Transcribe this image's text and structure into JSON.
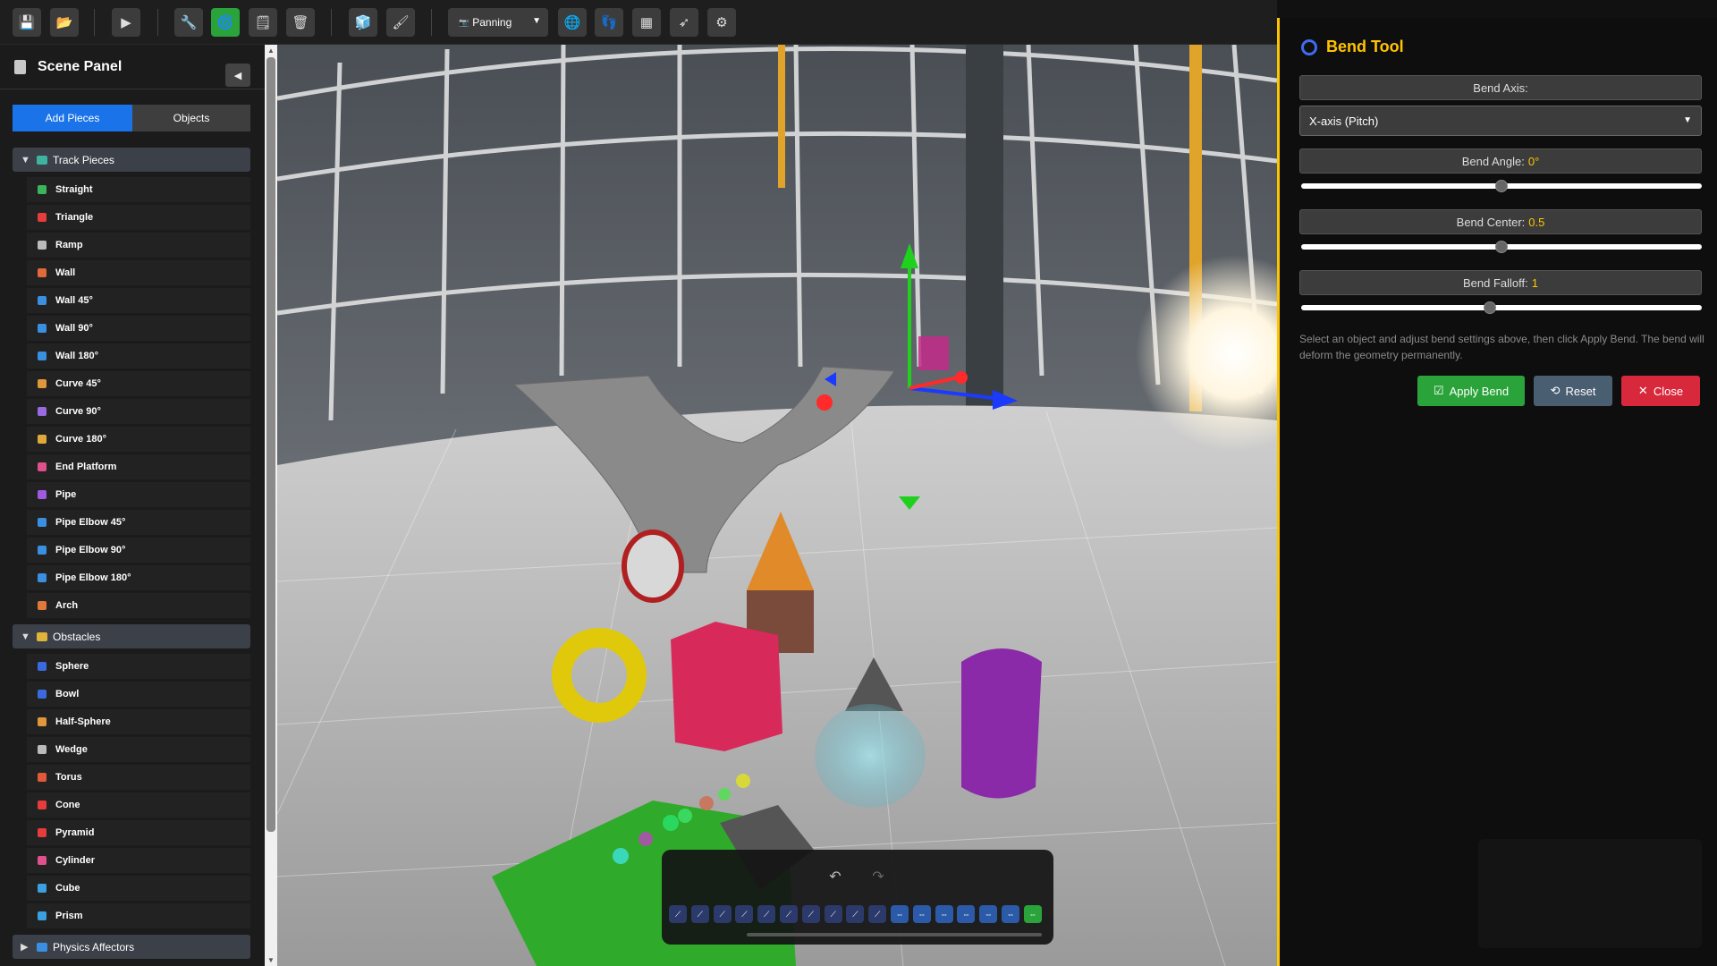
{
  "toolbar": {
    "buttons": [
      {
        "name": "save-button",
        "icon": "save-icon",
        "glyph": "💾"
      },
      {
        "name": "open-button",
        "icon": "folder-icon",
        "glyph": "📂"
      },
      {
        "name": "play-button",
        "icon": "play-icon",
        "glyph": "▶"
      },
      {
        "name": "tools-button",
        "icon": "wrench-icon",
        "glyph": "🔧"
      },
      {
        "name": "bend-tool-button",
        "icon": "bend-icon",
        "glyph": "🌀"
      },
      {
        "name": "notes-button",
        "icon": "notepad-icon",
        "glyph": "🗒"
      },
      {
        "name": "delete-button",
        "icon": "trash-icon",
        "glyph": "🗑"
      },
      {
        "name": "add-cube-button",
        "icon": "cube-icon",
        "glyph": "🧊"
      },
      {
        "name": "paint-button",
        "icon": "brush-icon",
        "glyph": "🖌"
      },
      {
        "name": "physics-button",
        "icon": "globe-icon",
        "glyph": "🌐"
      },
      {
        "name": "footprints-button",
        "icon": "footprints-icon",
        "glyph": "👣"
      },
      {
        "name": "checker-button",
        "icon": "checker-icon",
        "glyph": "▦"
      },
      {
        "name": "slide-button",
        "icon": "slide-icon",
        "glyph": "➶"
      },
      {
        "name": "settings-button",
        "icon": "gear-icon",
        "glyph": "⚙"
      }
    ],
    "mode": {
      "label": "Panning",
      "icon": "camera-icon"
    }
  },
  "scene_panel": {
    "title": "Scene Panel",
    "tabs": {
      "add": "Add Pieces",
      "objects": "Objects"
    },
    "categories": [
      {
        "label": "Track Pieces",
        "expanded": "▼",
        "color": "#3cb4a0",
        "items": [
          {
            "label": "Straight",
            "color": "#3cb45a"
          },
          {
            "label": "Triangle",
            "color": "#e63c3c"
          },
          {
            "label": "Ramp",
            "color": "#bbbbbb"
          },
          {
            "label": "Wall",
            "color": "#e06a3a"
          },
          {
            "label": "Wall 45°",
            "color": "#3a8fe0"
          },
          {
            "label": "Wall 90°",
            "color": "#3a8fe0"
          },
          {
            "label": "Wall 180°",
            "color": "#3a8fe0"
          },
          {
            "label": "Curve 45°",
            "color": "#e0963a"
          },
          {
            "label": "Curve 90°",
            "color": "#9a6ae0"
          },
          {
            "label": "Curve 180°",
            "color": "#e0a83a"
          },
          {
            "label": "End Platform",
            "color": "#e0508a"
          },
          {
            "label": "Pipe",
            "color": "#a05ae0"
          },
          {
            "label": "Pipe Elbow 45°",
            "color": "#3a8fe0"
          },
          {
            "label": "Pipe Elbow 90°",
            "color": "#3a8fe0"
          },
          {
            "label": "Pipe Elbow 180°",
            "color": "#3a8fe0"
          },
          {
            "label": "Arch",
            "color": "#e0783a"
          }
        ]
      },
      {
        "label": "Obstacles",
        "expanded": "▼",
        "color": "#e0b43a",
        "items": [
          {
            "label": "Sphere",
            "color": "#3a6ae0"
          },
          {
            "label": "Bowl",
            "color": "#3a6ae0"
          },
          {
            "label": "Half-Sphere",
            "color": "#e0963a"
          },
          {
            "label": "Wedge",
            "color": "#bbbbbb"
          },
          {
            "label": "Torus",
            "color": "#e05a3a"
          },
          {
            "label": "Cone",
            "color": "#e63c3c"
          },
          {
            "label": "Pyramid",
            "color": "#e63c3c"
          },
          {
            "label": "Cylinder",
            "color": "#e0508a"
          },
          {
            "label": "Cube",
            "color": "#3aa0e0"
          },
          {
            "label": "Prism",
            "color": "#3aa0e0"
          }
        ]
      },
      {
        "label": "Physics Affectors",
        "expanded": "▶",
        "color": "#3a8fe0",
        "items": []
      }
    ]
  },
  "bend_tool": {
    "title": "Bend Tool",
    "axis_label": "Bend Axis:",
    "axis_value": "X-axis (Pitch)",
    "angle_label": "Bend Angle:",
    "angle_value": "0°",
    "angle_level": 0.5,
    "center_label": "Bend Center:",
    "center_value": "0.5",
    "center_level": 0.5,
    "falloff_label": "Bend Falloff:",
    "falloff_value": "1",
    "falloff_level": 0.47,
    "help_text": "Select an object and adjust bend settings above, then click Apply Bend. The bend will deform the geometry permanently.",
    "apply_label": "Apply Bend",
    "reset_label": "Reset",
    "close_label": "Close",
    "accent": "#ffc400"
  },
  "history_bar": {
    "undo": "↶",
    "redo": "↷"
  }
}
